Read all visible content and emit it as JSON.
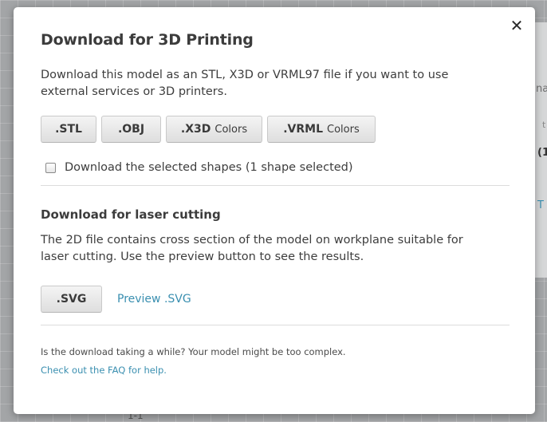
{
  "background": {
    "fragments": [
      "na",
      "(1",
      "T",
      "t",
      "1-1"
    ]
  },
  "modal": {
    "close_label": "✕",
    "title": "Download for 3D Printing",
    "description": "Download this model as an STL, X3D or VRML97 file if you want to use external services or 3D printers.",
    "buttons": [
      {
        "label": ".STL",
        "sub": ""
      },
      {
        "label": ".OBJ",
        "sub": ""
      },
      {
        "label": ".X3D",
        "sub": "Colors"
      },
      {
        "label": ".VRML",
        "sub": "Colors"
      }
    ],
    "checkbox": {
      "label": "Download the selected shapes (1 shape selected)",
      "checked": false
    },
    "laser": {
      "title": "Download for laser cutting",
      "description": "The 2D file contains cross section of the model on workplane suitable for laser cutting. Use the preview button to see the results.",
      "svg_button": ".SVG",
      "preview_link": "Preview .SVG"
    },
    "footer": {
      "text": "Is the download taking a while? Your model might be too complex.",
      "faq_link": "Check out the FAQ for help."
    }
  },
  "colors": {
    "link": "#3a8fb0",
    "text": "#3d3d3d",
    "overlay": "#a3a5a7"
  }
}
